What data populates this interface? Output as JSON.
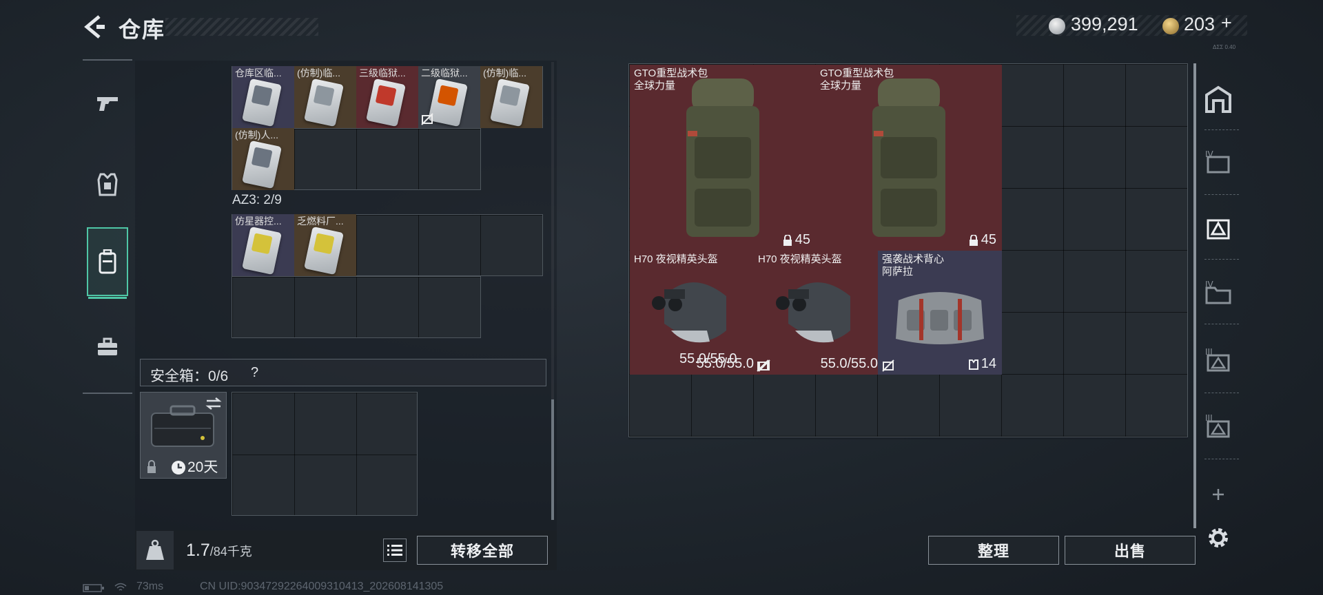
{
  "header": {
    "title": "仓库",
    "currency_silver": "399,291",
    "currency_gold": "203",
    "gold_add": "+",
    "tiny_version": "ΔΣΣ 0.40"
  },
  "left_nav": [
    {
      "name": "weapons",
      "icon": "pistol-icon",
      "active": false
    },
    {
      "name": "armor",
      "icon": "armor-icon",
      "active": false
    },
    {
      "name": "backpack",
      "icon": "backpack-icon",
      "active": true
    },
    {
      "name": "toolkit",
      "icon": "toolbox-icon",
      "active": false
    }
  ],
  "container1_items": [
    {
      "label": "仓库区临...",
      "band": "#6b7480"
    },
    {
      "label": "(仿制)临...",
      "band": "#8d969e"
    },
    {
      "label": "三级临狱...",
      "band": "#c0392b"
    },
    {
      "label": "二级临狱...",
      "band": "#d35400",
      "no_trade": true
    },
    {
      "label": "(仿制)临...",
      "band": "#8d969e"
    },
    {
      "label": "(仿制)人...",
      "band": "#6b7480"
    }
  ],
  "az3": {
    "label": "AZ3: 2/9",
    "items": [
      {
        "label": "仿星器控...",
        "band": "#d4c23a"
      },
      {
        "label": "乏燃料厂...",
        "band": "#d4c23a"
      }
    ]
  },
  "safe_box": {
    "label": "安全箱：0/6",
    "help": "?",
    "duration": "20天"
  },
  "bottom": {
    "weight_current": "1.7",
    "weight_max": "/84千克",
    "transfer_all": "转移全部"
  },
  "stash_items": [
    {
      "name": "GTO重型战术包\n全球力量",
      "stat": "45",
      "stat_icon": "lock-icon",
      "type": "backpack"
    },
    {
      "name": "GTO重型战术包\n全球力量",
      "stat": "45",
      "stat_icon": "lock-icon",
      "type": "backpack"
    },
    {
      "name": "H70 夜视精英头盔",
      "stat": "55.0/55.0",
      "stat_icon": "no-trade-icon",
      "type": "helmet"
    },
    {
      "name": "H70 夜视精英头盔",
      "stat": "55.0/55.0",
      "stat_icon": "no-trade-icon",
      "type": "helmet"
    },
    {
      "name": "强袭战术背心\n阿萨拉",
      "stat": "14",
      "stat_icon": "vest-stat-icon",
      "type": "vest"
    }
  ],
  "stash_buttons": {
    "sort": "整理",
    "sell": "出售"
  },
  "right_tabs": [
    {
      "icon": "stash-home-icon"
    },
    {
      "icon": "stash-tab-iv-icon"
    },
    {
      "icon": "stash-tab-active-icon"
    },
    {
      "icon": "stash-tab-folder-icon"
    },
    {
      "icon": "stash-tab-iii-icon"
    },
    {
      "icon": "stash-tab-iii-b-icon"
    }
  ],
  "status": {
    "ping": "73ms",
    "uid": "CN UID:90347292264009310413_202608141305"
  },
  "colors": {
    "accent": "#4fc7a6",
    "red_rarity": "#5a2a2f",
    "purple_rarity": "#3b3b52",
    "gold_rarity": "#4b3d2c"
  }
}
